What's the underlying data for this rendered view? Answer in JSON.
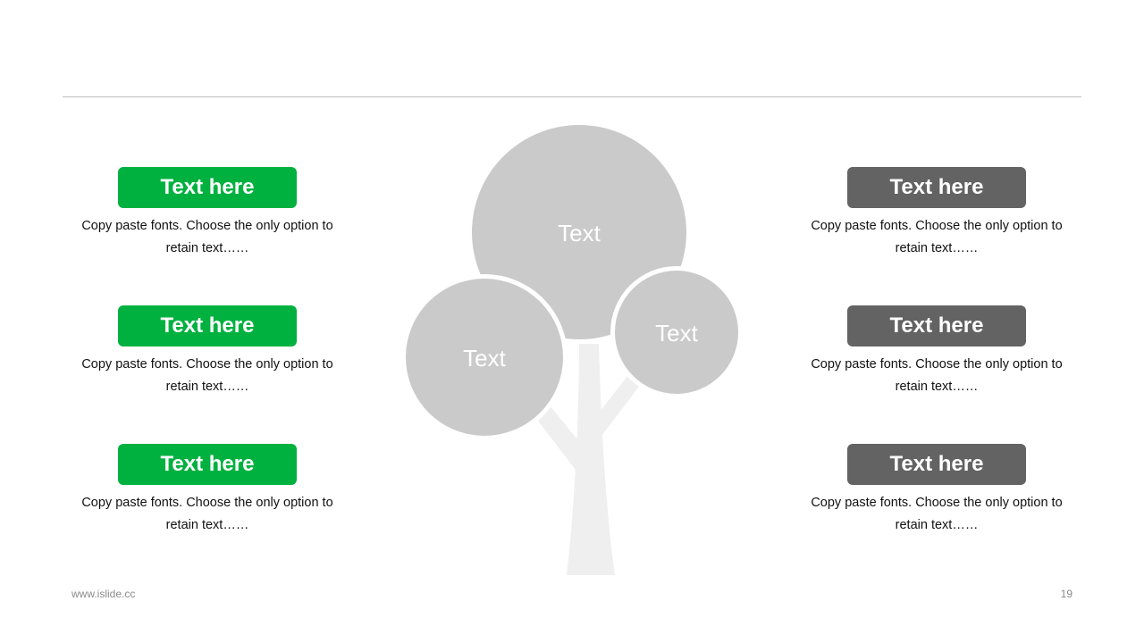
{
  "colors": {
    "left_accent": "#00b140",
    "right_accent": "#636363",
    "circle_fill": "#c6c6c6",
    "trunk_fill": "#efefef"
  },
  "left_items": [
    {
      "title": "Text here",
      "desc": "Copy paste fonts. Choose the only option to retain text……"
    },
    {
      "title": "Text here",
      "desc": "Copy paste fonts. Choose the only option to retain text……"
    },
    {
      "title": "Text here",
      "desc": "Copy paste fonts. Choose the only option to retain text……"
    }
  ],
  "right_items": [
    {
      "title": "Text here",
      "desc": "Copy paste fonts. Choose the only option to retain text……"
    },
    {
      "title": "Text here",
      "desc": "Copy paste fonts. Choose the only option to retain text……"
    },
    {
      "title": "Text here",
      "desc": "Copy paste fonts. Choose the only option to retain text……"
    }
  ],
  "tree": {
    "top_label": "Text",
    "left_label": "Text",
    "right_label": "Text"
  },
  "footer": {
    "website": "www.islide.cc",
    "page_number": "19"
  }
}
